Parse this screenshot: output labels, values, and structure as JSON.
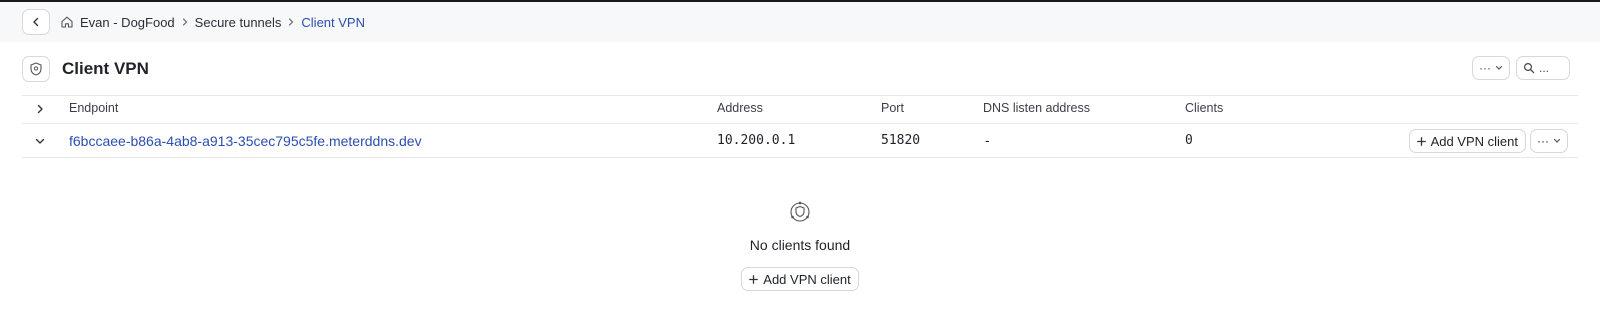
{
  "breadcrumb": {
    "items": [
      {
        "label": "Evan - DogFood"
      },
      {
        "label": "Secure tunnels"
      },
      {
        "label": "Client VPN"
      }
    ]
  },
  "header": {
    "title": "Client VPN",
    "more_label": "···",
    "search_label": "..."
  },
  "table": {
    "columns": [
      "Endpoint",
      "Address",
      "Port",
      "DNS listen address",
      "Clients"
    ],
    "rows": [
      {
        "endpoint": "f6bccaee-b86a-4ab8-a913-35cec795c5fe.meterddns.dev",
        "address": "10.200.0.1",
        "port": "51820",
        "dns": "-",
        "clients": "0",
        "add_label": "Add VPN client",
        "more_label": "···"
      }
    ]
  },
  "empty_state": {
    "title": "No clients found",
    "button_label": "Add VPN client"
  },
  "colors": {
    "link": "#2a4fb0",
    "border": "#d6d8dc",
    "crumb_bg": "#f7f8fa"
  },
  "icons": [
    "chevron-left-icon",
    "home-icon",
    "vpn-shield-icon",
    "chevron-right-icon",
    "chevron-down-icon",
    "search-icon",
    "plus-icon",
    "more-icon"
  ]
}
